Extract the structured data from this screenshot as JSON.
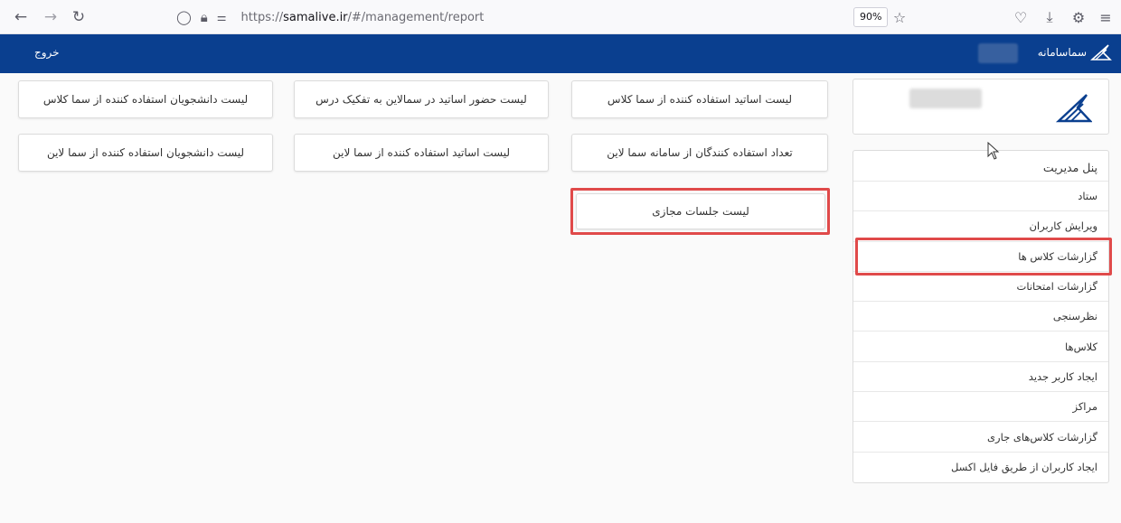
{
  "browser": {
    "url_prefix": "https://",
    "url_domain": "samalive.ir",
    "url_path": "/#/management/report",
    "zoom": "90%"
  },
  "header": {
    "logout_label": "خروج",
    "brand_name": "سماسامانه"
  },
  "reports": {
    "row1": [
      "لیست دانشجویان استفاده کننده از سما کلاس",
      "لیست حضور اساتید در سمالاین به تفکیک درس",
      "لیست اساتید استفاده کننده از سما کلاس"
    ],
    "row2": [
      "لیست دانشجویان استفاده کننده از سما لاین",
      "لیست اساتید استفاده کننده از سما لاین",
      "تعداد استفاده کنندگان از سامانه سما لاین"
    ],
    "virtual_sessions": "لیست جلسات مجازی"
  },
  "menu": {
    "items": [
      "پنل مدیریت",
      "ستاد",
      "ویرایش کاربران",
      "گزارشات کلاس ها",
      "گزارشات امتحانات",
      "نظرسنجی",
      "کلاس‌ها",
      "ایجاد کاربر جدید",
      "مراکز",
      "گزارشات کلاس‌های جاری",
      "ایجاد کاربران از طریق فایل اکسل"
    ]
  },
  "colors": {
    "header_bg": "#0a3f8f",
    "highlight": "#e04a4a"
  }
}
